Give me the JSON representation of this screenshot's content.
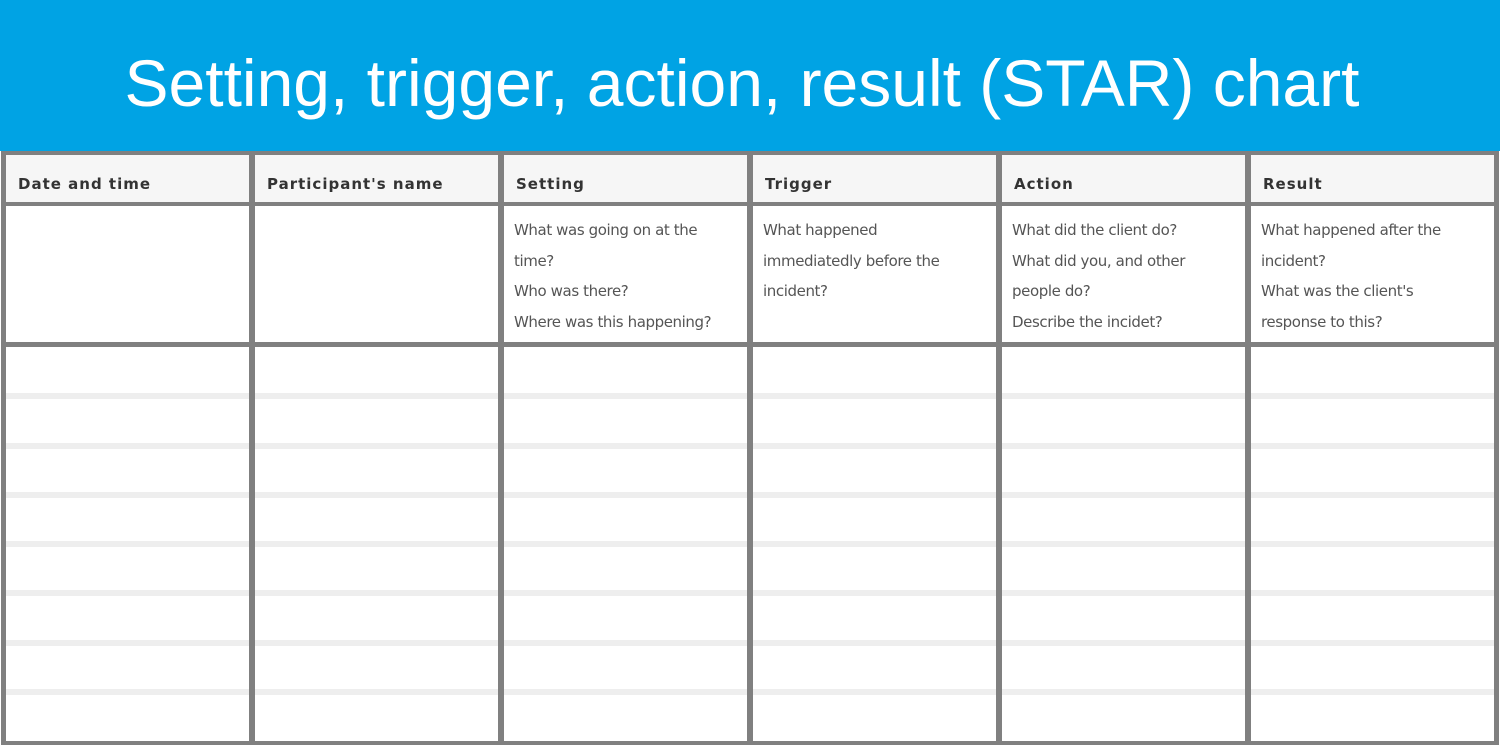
{
  "header": {
    "title": "Setting, trigger, action, result (STAR) chart",
    "banner_color": "#00a3e4"
  },
  "table": {
    "columns": [
      {
        "label": "Date and time",
        "prompt_lines": []
      },
      {
        "label": "Participant's name",
        "prompt_lines": []
      },
      {
        "label": "Setting",
        "prompt_lines": [
          "What was going on at the",
          "time?",
          "Who was there?",
          "Where was this happening?"
        ]
      },
      {
        "label": "Trigger",
        "prompt_lines": [
          "What happened",
          "immediatedly before the",
          "incident?"
        ]
      },
      {
        "label": "Action",
        "prompt_lines": [
          "What did the client do?",
          "What did you, and other",
          "people do?",
          "Describe the incidet?"
        ]
      },
      {
        "label": "Result",
        "prompt_lines": [
          "What happened after the",
          "incident?",
          "What was the client's",
          "response to this?"
        ]
      }
    ],
    "blank_rows": 8
  }
}
